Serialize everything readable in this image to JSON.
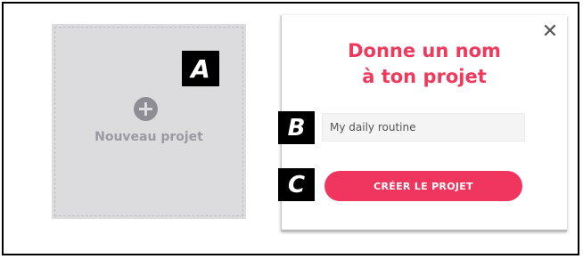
{
  "new_project": {
    "label": "Nouveau projet",
    "icon": "plus-circle-icon"
  },
  "markers": {
    "a": "A",
    "b": "B",
    "c": "C"
  },
  "dialog": {
    "title_line1": "Donne un nom",
    "title_line2": "à ton projet",
    "close_icon": "close-icon",
    "name_input": {
      "value": "My daily routine",
      "placeholder": ""
    },
    "create_button_label": "CRÉER LE PROJET"
  },
  "colors": {
    "accent": "#f0365f",
    "title": "#ef3a5d",
    "card_bg": "#dcdcdf"
  }
}
